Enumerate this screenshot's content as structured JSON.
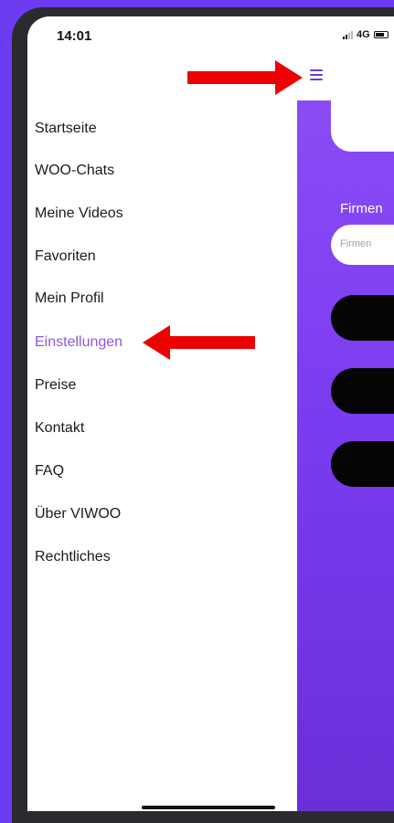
{
  "status_bar": {
    "time": "14:01",
    "network": "4G"
  },
  "menu": {
    "items": [
      {
        "label": "Startseite",
        "active": false
      },
      {
        "label": "WOO-Chats",
        "active": false
      },
      {
        "label": "Meine Videos",
        "active": false
      },
      {
        "label": "Favoriten",
        "active": false
      },
      {
        "label": "Mein Profil",
        "active": false
      },
      {
        "label": "Einstellungen",
        "active": true
      },
      {
        "label": "Preise",
        "active": false
      },
      {
        "label": "Kontakt",
        "active": false
      },
      {
        "label": "FAQ",
        "active": false
      },
      {
        "label": "Über VIWOO",
        "active": false
      },
      {
        "label": "Rechtliches",
        "active": false
      }
    ]
  },
  "background_screen": {
    "field_label": "Firmen",
    "field_placeholder": "Firmen"
  },
  "colors": {
    "background": "#6c3bf2",
    "accent": "#8e55e6",
    "gradient_top": "#8a4cf5",
    "gradient_bottom": "#6a2fd8",
    "annotation_arrow": "#ee0000"
  },
  "icons": [
    "menu-hamburger-icon",
    "signal-icon",
    "battery-icon",
    "annotation-arrow-icon"
  ]
}
